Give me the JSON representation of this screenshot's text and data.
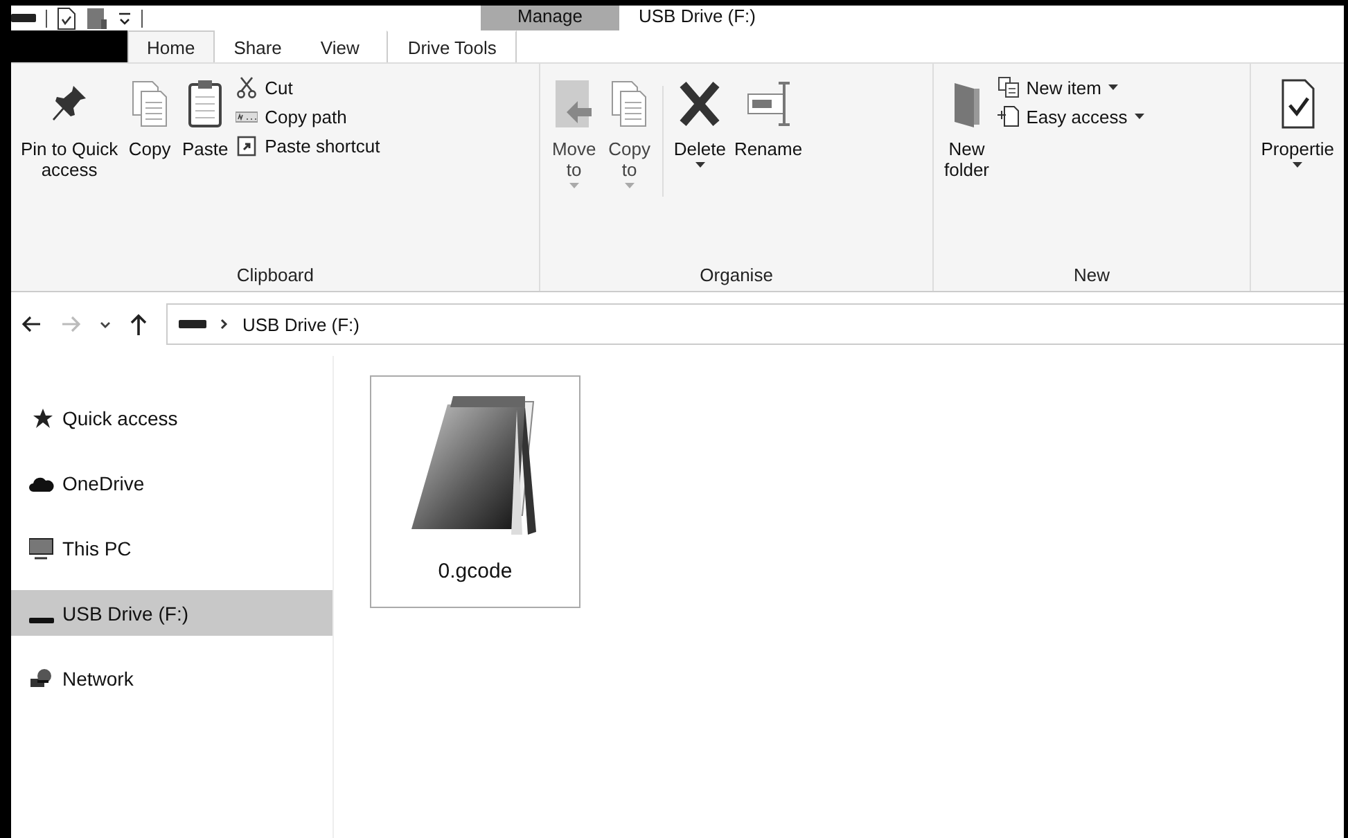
{
  "window": {
    "title": "USB Drive (F:)",
    "context_tab": "Manage"
  },
  "tabs": [
    {
      "label": "Home",
      "selected": true
    },
    {
      "label": "Share",
      "selected": false
    },
    {
      "label": "View",
      "selected": false
    },
    {
      "label": "Drive Tools",
      "selected": false,
      "kind": "context"
    }
  ],
  "ribbon": {
    "groups": [
      {
        "label": "Clipboard",
        "items": [
          {
            "kind": "large",
            "label": "Pin to Quick\naccess",
            "disabled": false,
            "dropdown": false
          },
          {
            "kind": "large",
            "label": "Copy",
            "disabled": false,
            "dropdown": false
          },
          {
            "kind": "large",
            "label": "Paste",
            "disabled": false,
            "dropdown": false
          },
          {
            "kind": "stack",
            "children": [
              {
                "label": "Cut",
                "dropdown": false
              },
              {
                "label": "Copy path",
                "dropdown": false
              },
              {
                "label": "Paste shortcut",
                "dropdown": false
              }
            ]
          }
        ]
      },
      {
        "label": "Organise",
        "items": [
          {
            "kind": "large",
            "label": "Move\nto",
            "disabled": true,
            "dropdown": true
          },
          {
            "kind": "large",
            "label": "Copy\nto",
            "disabled": true,
            "dropdown": true
          },
          {
            "kind": "sep"
          },
          {
            "kind": "large",
            "label": "Delete",
            "disabled": false,
            "dropdown": true
          },
          {
            "kind": "large",
            "label": "Rename",
            "disabled": false,
            "dropdown": false
          }
        ]
      },
      {
        "label": "New",
        "items": [
          {
            "kind": "large",
            "label": "New\nfolder",
            "disabled": false,
            "dropdown": false
          },
          {
            "kind": "stack",
            "children": [
              {
                "label": "New item",
                "dropdown": true
              },
              {
                "label": "Easy access",
                "dropdown": true
              }
            ]
          }
        ]
      },
      {
        "items": [
          {
            "kind": "large",
            "label": "Propertie",
            "disabled": false,
            "dropdown": true
          }
        ]
      }
    ]
  },
  "address": {
    "path": "USB Drive (F:)"
  },
  "nav": [
    {
      "label": "Quick access",
      "selected": false
    },
    {
      "label": "OneDrive",
      "selected": false
    },
    {
      "label": "This PC",
      "selected": false
    },
    {
      "label": "USB Drive (F:)",
      "selected": true
    },
    {
      "label": "Network",
      "selected": false
    }
  ],
  "files": [
    {
      "name": "0.gcode",
      "selected": true
    }
  ]
}
